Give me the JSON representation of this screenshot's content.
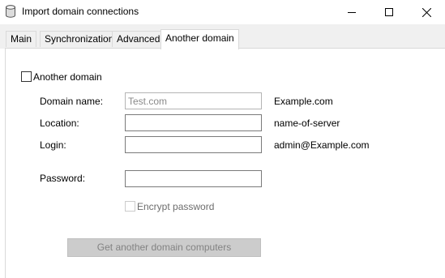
{
  "window": {
    "title": "Import domain connections",
    "icon": "database-icon",
    "controls": {
      "minimize": "minimize-icon",
      "maximize": "maximize-icon",
      "close": "close-icon"
    }
  },
  "tabs": [
    {
      "label": "Main",
      "active": false
    },
    {
      "label": "Synchronization",
      "active": false
    },
    {
      "label": "Advanced",
      "active": false
    },
    {
      "label": "Another domain",
      "active": true
    }
  ],
  "form": {
    "another_domain_checkbox": {
      "label": "Another domain",
      "checked": false
    },
    "domain_name": {
      "label": "Domain name:",
      "value": "",
      "placeholder": "Test.com",
      "hint": "Example.com"
    },
    "location": {
      "label": "Location:",
      "value": "",
      "hint": "name-of-server"
    },
    "login": {
      "label": "Login:",
      "value": "",
      "hint": "admin@Example.com"
    },
    "password": {
      "label": "Password:",
      "value": ""
    },
    "encrypt_password": {
      "label": "Encrypt password",
      "checked": false,
      "enabled": false
    },
    "get_computers_button": {
      "label": "Get another domain computers",
      "enabled": false
    }
  }
}
